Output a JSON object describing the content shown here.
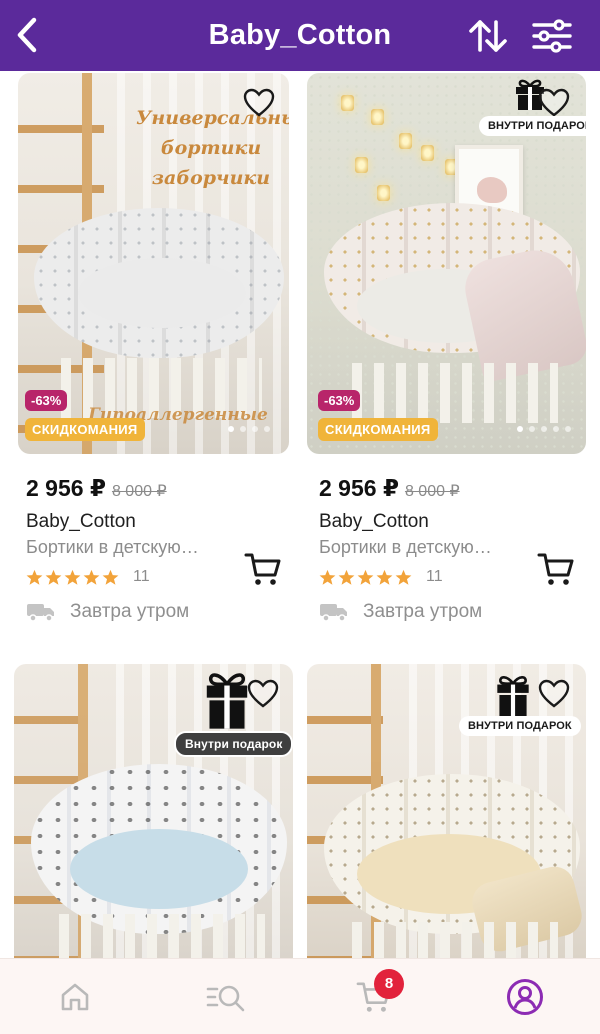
{
  "header": {
    "title": "Baby_Cotton",
    "background": "#5b2a9b"
  },
  "products": [
    {
      "price": "2 956 ₽",
      "old_price": "8 000 ₽",
      "brand": "Baby_Cotton",
      "name": "Бортики в детскую…",
      "rating": 5,
      "reviews": "11",
      "delivery": "Завтра утром",
      "discount": "-63%",
      "promo": "СКИДКОМАНИЯ",
      "image_text_top": "Универсальные бортики заборчики",
      "image_text_bottom": "Гипоаллергенные"
    },
    {
      "price": "2 956 ₽",
      "old_price": "8 000 ₽",
      "brand": "Baby_Cotton",
      "name": "Бортики в детскую…",
      "rating": 5,
      "reviews": "11",
      "delivery": "Завтра утром",
      "discount": "-63%",
      "promo": "СКИДКОМАНИЯ",
      "gift_label": "ВНУТРИ ПОДАРОК"
    },
    {
      "gift_label": "Внутри подарок"
    },
    {
      "gift_label": "ВНУТРИ ПОДАРОК"
    }
  ],
  "bottom_nav": {
    "items": [
      "home-icon",
      "catalog-search-icon",
      "cart-icon",
      "profile-icon"
    ],
    "cart_badge": "8",
    "active": "profile-icon"
  },
  "colors": {
    "accent": "#5b2a9b",
    "discount": "#b8256a",
    "promo": "#f0b43a",
    "star": "#f2a33a",
    "badge": "#e2223b"
  }
}
